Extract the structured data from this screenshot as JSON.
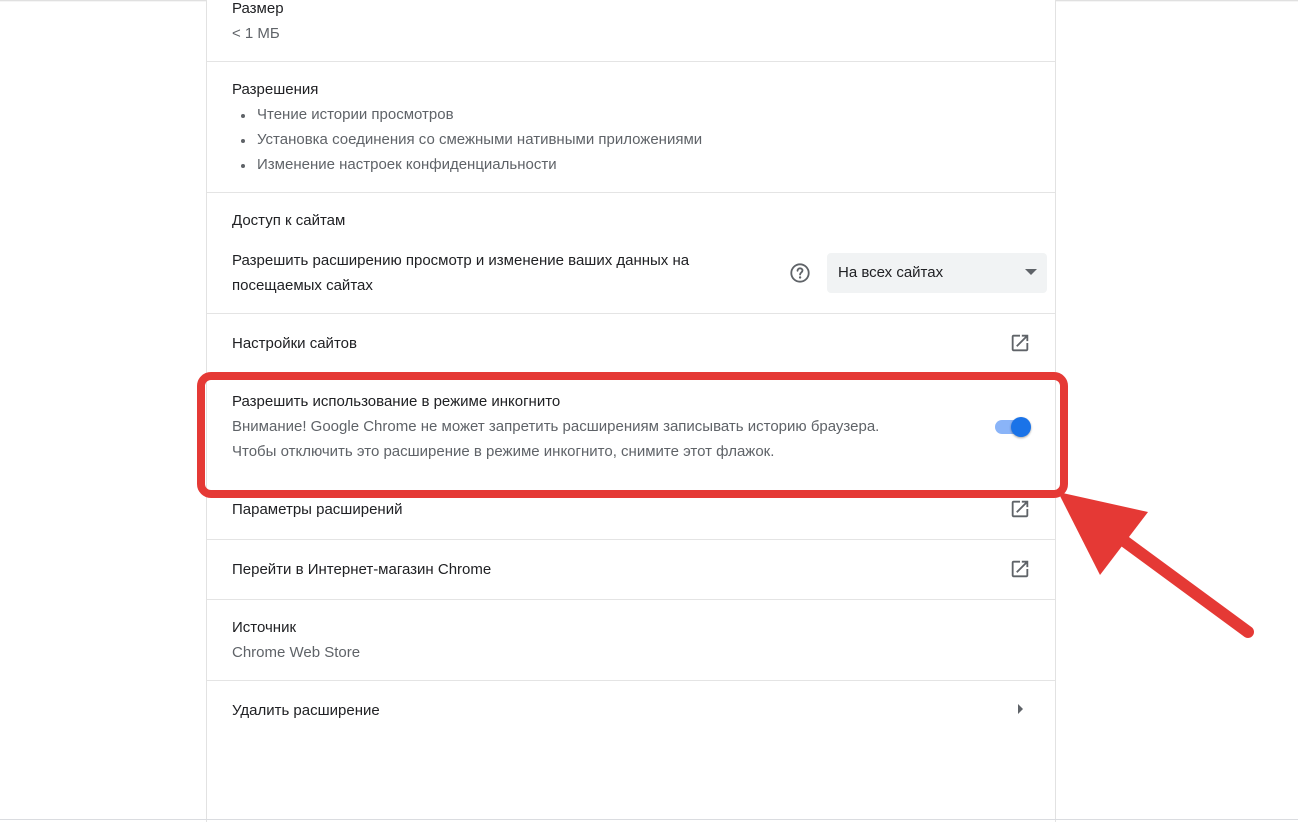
{
  "size": {
    "label": "Размер",
    "value": "< 1 МБ"
  },
  "permissions": {
    "label": "Разрешения",
    "items": [
      "Чтение истории просмотров",
      "Установка соединения со смежными нативными приложениями",
      "Изменение настроек конфиденциальности"
    ]
  },
  "site_access": {
    "label": "Доступ к сайтам",
    "description_line1": "Разрешить расширению просмотр и изменение ваших данных на",
    "description_line2": "посещаемых сайтах",
    "help_icon": "help-circle-icon",
    "dropdown_value": "На всех сайтах"
  },
  "site_settings": {
    "label": "Настройки сайтов",
    "icon": "open-in-new-icon"
  },
  "incognito": {
    "label": "Разрешить использование в режиме инкогнито",
    "warning_line1": "Внимание! Google Chrome не может запретить расширениям записывать историю браузера.",
    "warning_line2": "Чтобы отключить это расширение в режиме инкогнито, снимите этот флажок.",
    "toggle_on": true,
    "toggle_color": "#1a73e8",
    "toggle_track_color": "#8ab4f8"
  },
  "extension_options": {
    "label": "Параметры расширений",
    "icon": "open-in-new-icon"
  },
  "web_store": {
    "label": "Перейти в Интернет-магазин Chrome",
    "icon": "open-in-new-icon"
  },
  "source": {
    "label": "Источник",
    "value": "Chrome Web Store"
  },
  "remove": {
    "label": "Удалить расширение",
    "icon": "chevron-right-icon"
  },
  "annotation": {
    "highlight_color": "#e53935"
  }
}
